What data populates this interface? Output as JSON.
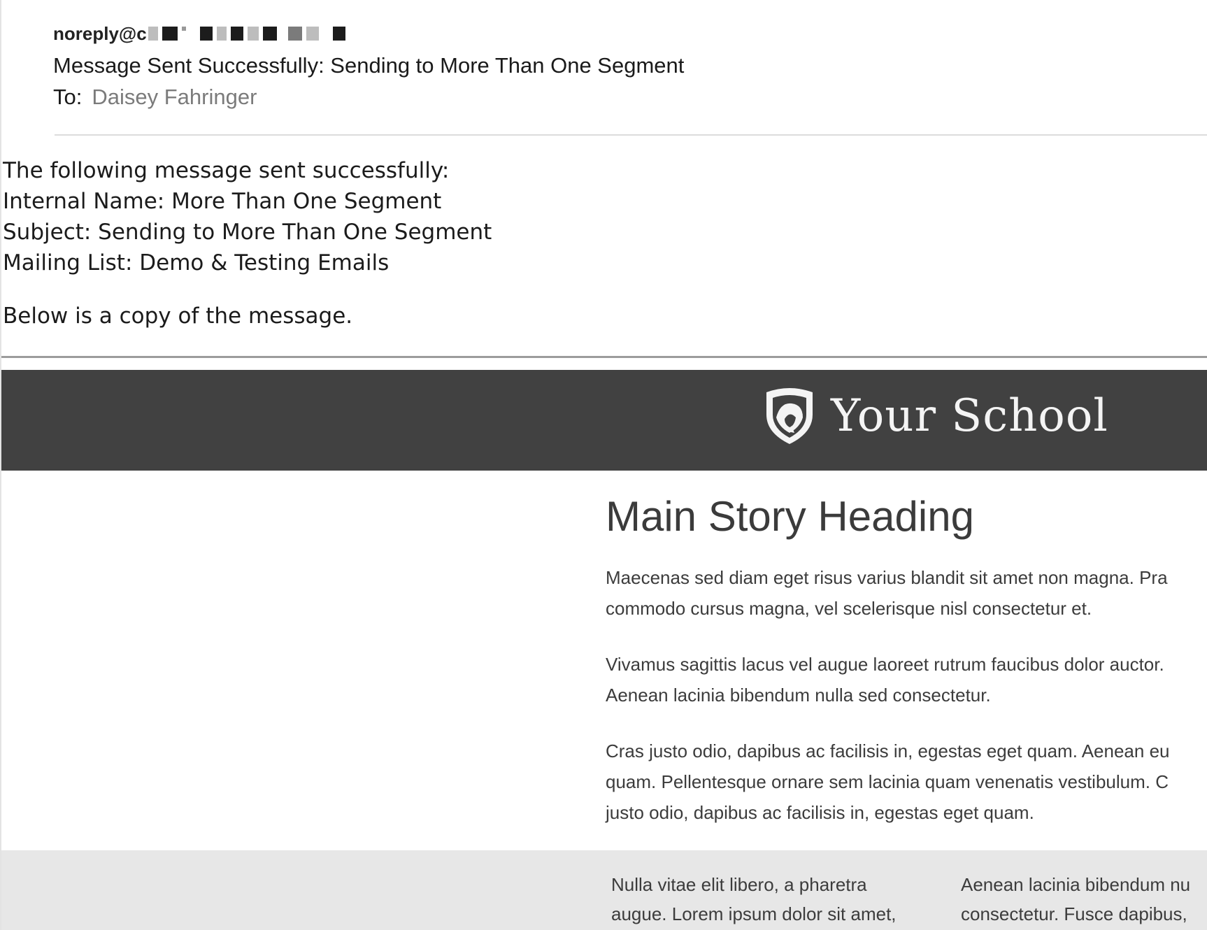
{
  "email": {
    "sender": "noreply@c",
    "subject": "Message Sent Successfully: Sending to More Than One Segment",
    "to_label": "To:",
    "to_value": "Daisey Fahringer"
  },
  "notice": {
    "line1": "The following message sent successfully:",
    "line2": "Internal Name: More Than One Segment",
    "line3": "Subject: Sending to More Than One Segment",
    "line4": "Mailing List: Demo & Testing Emails",
    "below": "Below is a copy of the message."
  },
  "newsletter": {
    "brand_name": "Your School",
    "banner_color": "#414141",
    "story": {
      "heading": "Main Story Heading",
      "p1_line1": "Maecenas sed diam eget risus varius blandit sit amet non magna. Pra",
      "p1_line2": "commodo cursus magna, vel scelerisque nisl consectetur et.",
      "p2_line1": "Vivamus sagittis lacus vel augue laoreet rutrum faucibus dolor auctor.",
      "p2_line2": "Aenean lacinia bibendum nulla sed consectetur.",
      "p3_line1": "Cras justo odio, dapibus ac facilisis in, egestas eget quam. Aenean eu",
      "p3_line2": "quam. Pellentesque ornare sem lacinia quam venenatis vestibulum. C",
      "p3_line3": "justo odio, dapibus ac facilisis in, egestas eget quam."
    },
    "columns": {
      "left_line1": "Nulla vitae elit libero, a pharetra",
      "left_line2": "augue. Lorem ipsum dolor sit amet,",
      "right_line1": "Aenean lacinia bibendum nu",
      "right_line2": "consectetur. Fusce dapibus,"
    }
  },
  "icons": {
    "brand_logo": "shield-logo-icon"
  }
}
